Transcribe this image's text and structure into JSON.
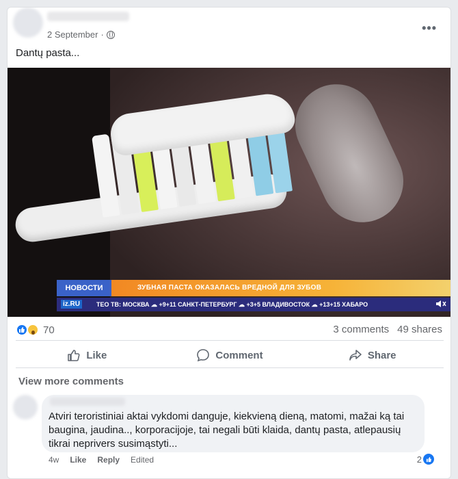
{
  "post": {
    "date": "2 September",
    "more_label": "•••",
    "text": "Dantų pasta..."
  },
  "video": {
    "channel_tag": "НОВОСТИ",
    "headline": "ЗУБНАЯ ПАСТА ОКАЗАЛАСЬ ВРЕДНОЙ ДЛЯ ЗУБОВ",
    "logo": "iz.RU",
    "ticker": "ТЕО ТВ:  МОСКВА ☁ +9+11  САНКТ-ПЕТЕРБУРГ ☁ +3+5  ВЛАДИВОСТОК ☁ +13+15  ХАБАРО",
    "bristle_colors": [
      "#f4f4f4",
      "#ebebeb",
      "#d8ef5a",
      "#f4f4f4",
      "#e9e9e9",
      "#f2f2f2",
      "#d6ec5a",
      "#f0f0f0",
      "#8fcde6",
      "#9bd3ea"
    ]
  },
  "stats": {
    "reaction_count": "70",
    "comments": "3 comments",
    "shares": "49 shares"
  },
  "actions": {
    "like": "Like",
    "comment": "Comment",
    "share": "Share"
  },
  "comments": {
    "view_more": "View more comments",
    "items": [
      {
        "text": "Atviri teroristiniai aktai vykdomi danguje, kiekvieną dieną, matomi, mažai ką tai baugina, jaudina.., korporacijoje, tai negali būti klaida, dantų pasta, atlepausių tikrai neprivers susimąstyti...",
        "age": "4w",
        "like": "Like",
        "reply": "Reply",
        "edited": "Edited",
        "reaction_count": "2"
      }
    ]
  },
  "colors": {
    "accent": "#1877f2",
    "muted": "#65676b"
  }
}
